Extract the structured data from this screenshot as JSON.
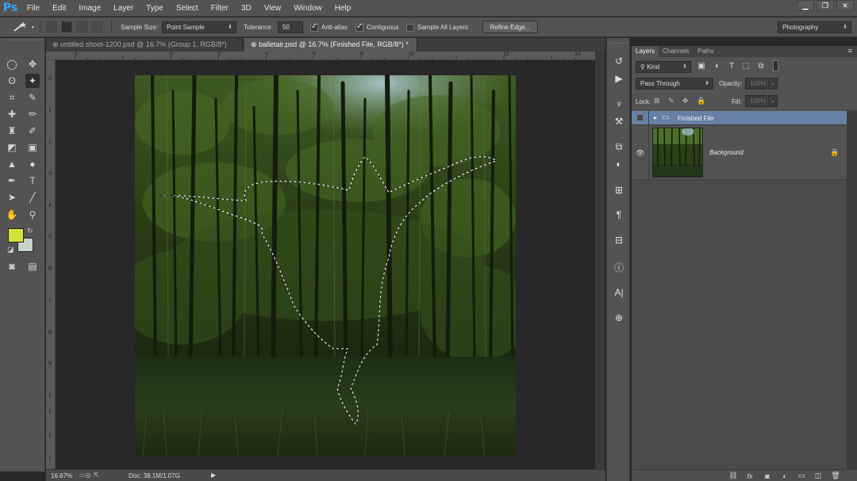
{
  "app": {
    "logo": "Ps"
  },
  "menu": [
    "File",
    "Edit",
    "Image",
    "Layer",
    "Type",
    "Select",
    "Filter",
    "3D",
    "View",
    "Window",
    "Help"
  ],
  "window_controls": {
    "minimize": "▁",
    "restore": "❐",
    "close": "✕"
  },
  "options": {
    "sample_size_label": "Sample Size:",
    "sample_size_value": "Point Sample",
    "tolerance_label": "Tolerance:",
    "tolerance_value": "50",
    "anti_alias_label": "Anti-alias",
    "anti_alias_checked": true,
    "contiguous_label": "Contiguous",
    "contiguous_checked": true,
    "sample_all_layers_label": "Sample All Layers",
    "sample_all_layers_checked": false,
    "refine_edge_label": "Refine Edge...",
    "workspace_value": "Photography"
  },
  "tabs": [
    {
      "label": "untitled shoot-1200.psd @ 16.7% (Group 1, RGB/8*)",
      "active": false
    },
    {
      "label": "balletair.psd @ 16.7% (Finished File, RGB/8*) *",
      "active": true
    }
  ],
  "ruler_top": [
    "2",
    "0",
    "2",
    "4",
    "6",
    "8",
    "10",
    "12",
    "14"
  ],
  "ruler_left": [
    "0",
    "1",
    "2",
    "3",
    "4",
    "5",
    "6",
    "7",
    "8",
    "9",
    "1",
    "1",
    "1",
    "1"
  ],
  "status": {
    "zoom": "16.67%",
    "doc": "Doc: 38.1M/1.07G"
  },
  "colors": {
    "foreground": "#d6e03a",
    "background": "#c5d3c9",
    "accent_selected_layer": "#6680a6"
  },
  "layers_panel": {
    "tabs": [
      "Layers",
      "Channels",
      "Paths"
    ],
    "kind_label": "Kind",
    "blend_mode": "Pass Through",
    "opacity_label": "Opacity:",
    "opacity_value": "100%",
    "lock_label": "Lock:",
    "fill_label": "Fill:",
    "fill_value": "100%",
    "layers": [
      {
        "name": "Finished File",
        "type": "group",
        "selected": true
      },
      {
        "name": "Background",
        "type": "image",
        "selected": false,
        "locked": true
      }
    ]
  },
  "icons": {
    "tools": [
      "move-icon",
      "marquee-icon",
      "lasso-icon",
      "magic-wand-icon",
      "crop-icon",
      "eyedropper-icon",
      "healing-brush-icon",
      "brush-icon",
      "clone-stamp-icon",
      "history-brush-icon",
      "eraser-icon",
      "gradient-icon",
      "blur-icon",
      "dodge-icon",
      "pen-icon",
      "type-icon",
      "path-selection-icon",
      "line-icon",
      "hand-icon",
      "zoom-icon"
    ],
    "dock": [
      "history-icon",
      "actions-icon",
      "brush-presets-icon",
      "tool-presets-icon",
      "clone-source-icon",
      "adjustments-icon",
      "character-icon",
      "paragraph-icon",
      "properties-icon",
      "info-icon",
      "character-styles-icon",
      "layer-comps-icon"
    ]
  }
}
